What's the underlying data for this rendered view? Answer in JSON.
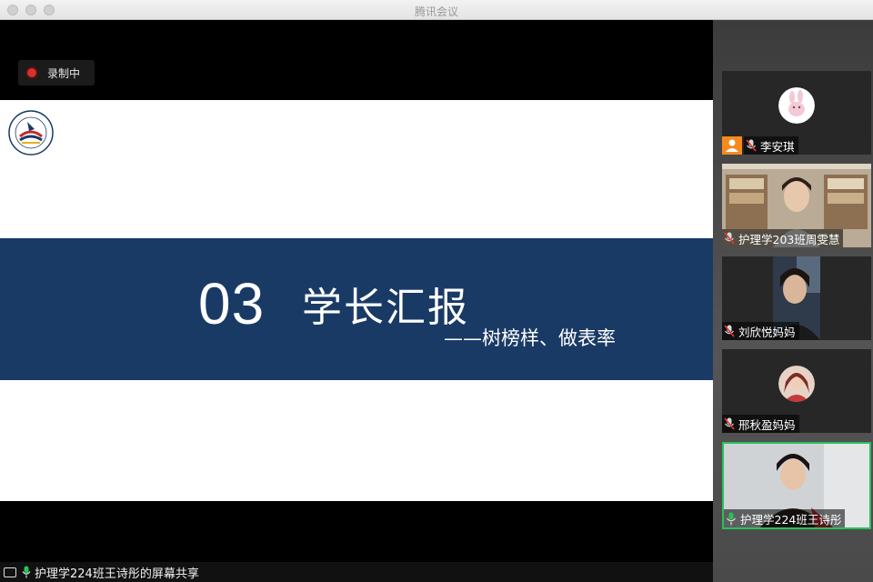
{
  "window": {
    "title": "腾讯会议"
  },
  "recording": {
    "label": "录制中",
    "color": "#d8302c"
  },
  "slide": {
    "number": "03",
    "title": "学长汇报",
    "subtitle": "——树榜样、做表率",
    "band_color": "#1a3a66"
  },
  "share_caption": {
    "text": "护理学224班王诗彤的屏幕共享"
  },
  "participants": [
    {
      "name": "李安琪",
      "type": "avatar",
      "host": true,
      "active": false
    },
    {
      "name": "护理学203班周雯慧",
      "type": "video",
      "host": false,
      "active": false
    },
    {
      "name": "刘欣悦妈妈",
      "type": "video",
      "host": false,
      "active": false
    },
    {
      "name": "邢秋盈妈妈",
      "type": "avatar",
      "host": false,
      "active": false
    },
    {
      "name": "护理学224班王诗彤",
      "type": "video",
      "host": false,
      "active": true
    }
  ],
  "colors": {
    "active_speaker_border": "#29c15a",
    "host_badge": "#f58a1f"
  }
}
